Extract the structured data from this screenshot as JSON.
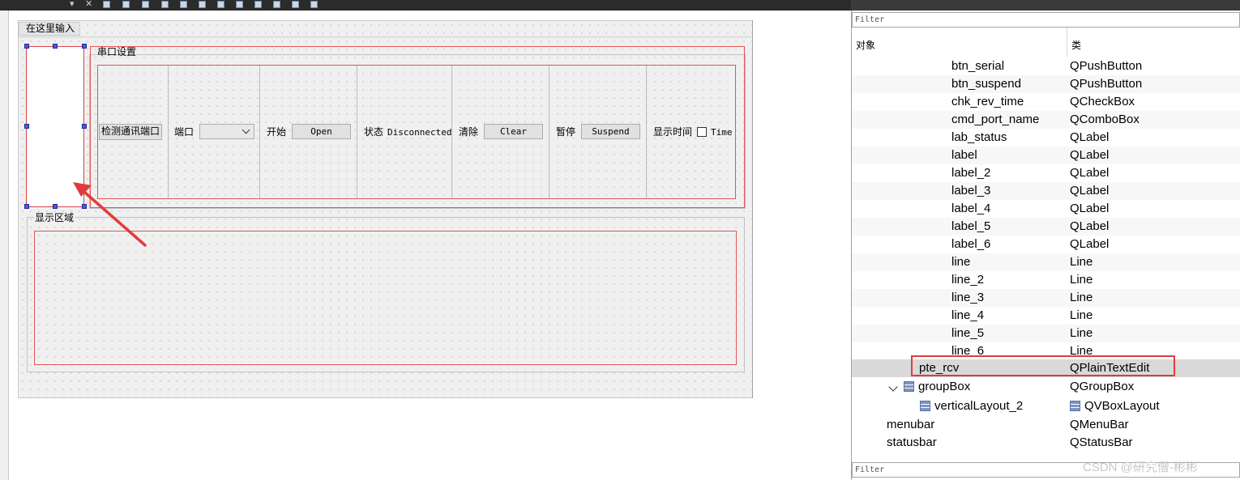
{
  "toolbar": {
    "close_glyph": "✕",
    "dropdown_glyph": "▾"
  },
  "form": {
    "menu_input": "在这里输入",
    "serial_group": {
      "title": "串口设置",
      "detect_button": "检测通讯端口",
      "port_label": "端口",
      "start_label": "开始",
      "open_button": "Open",
      "status_label": "状态",
      "status_value": "Disconnected",
      "clear_label": "清除",
      "clear_button": "Clear",
      "pause_label": "暂停",
      "suspend_button": "Suspend",
      "show_time_label": "显示时间",
      "time_checkbox_label": "Time"
    },
    "display_group": {
      "title": "显示区域"
    }
  },
  "inspector": {
    "filter_top": "Filter",
    "filter_bottom": "Filter",
    "col_object": "对象",
    "col_class": "类",
    "rows": [
      {
        "name": "btn_serial",
        "cls": "QPushButton"
      },
      {
        "name": "btn_suspend",
        "cls": "QPushButton"
      },
      {
        "name": "chk_rev_time",
        "cls": "QCheckBox"
      },
      {
        "name": "cmd_port_name",
        "cls": "QComboBox"
      },
      {
        "name": "lab_status",
        "cls": "QLabel"
      },
      {
        "name": "label",
        "cls": "QLabel"
      },
      {
        "name": "label_2",
        "cls": "QLabel"
      },
      {
        "name": "label_3",
        "cls": "QLabel"
      },
      {
        "name": "label_4",
        "cls": "QLabel"
      },
      {
        "name": "label_5",
        "cls": "QLabel"
      },
      {
        "name": "label_6",
        "cls": "QLabel"
      },
      {
        "name": "line",
        "cls": "Line"
      },
      {
        "name": "line_2",
        "cls": "Line"
      },
      {
        "name": "line_3",
        "cls": "Line"
      },
      {
        "name": "line_4",
        "cls": "Line"
      },
      {
        "name": "line_5",
        "cls": "Line"
      },
      {
        "name": "line_6",
        "cls": "Line"
      }
    ],
    "selected": {
      "name": "pte_rcv",
      "cls": "QPlainTextEdit"
    },
    "groupbox": {
      "name": "groupBox",
      "cls": "QGroupBox"
    },
    "vlayout": {
      "name": "verticalLayout_2",
      "cls": "QVBoxLayout"
    },
    "menubar": {
      "name": "menubar",
      "cls": "QMenuBar"
    },
    "statusbar": {
      "name": "statusbar",
      "cls": "QStatusBar"
    }
  },
  "watermark": "CSDN @研究僧-彬彬",
  "colors": {
    "annotation_red": "#e23b3b",
    "selection_handle": "#4a5bd4"
  }
}
